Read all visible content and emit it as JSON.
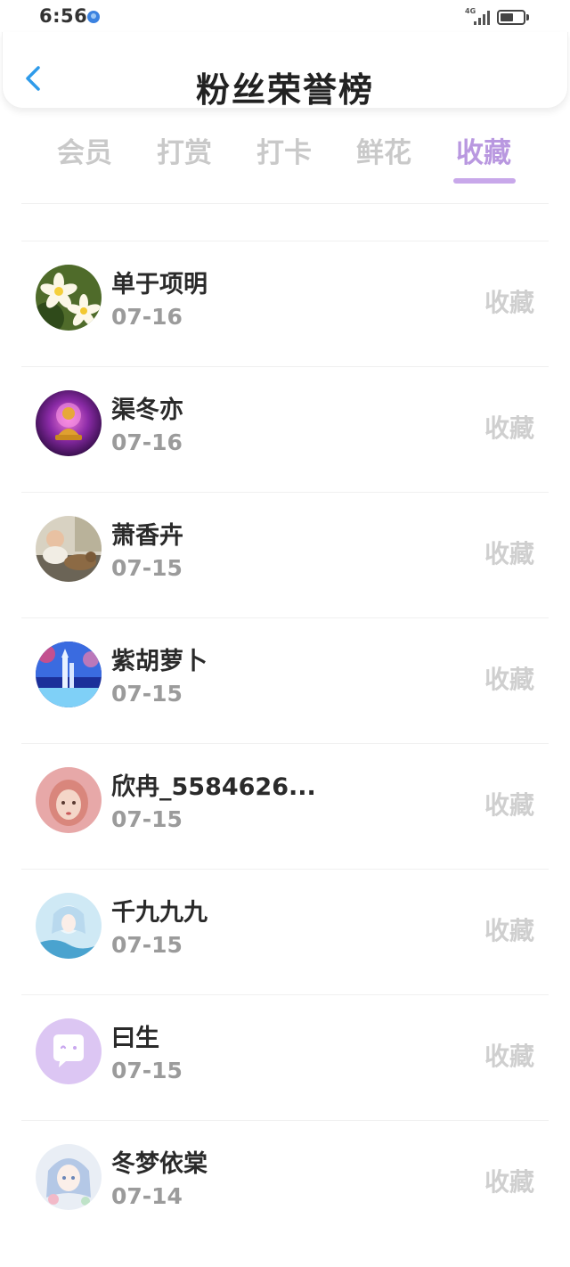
{
  "status_bar": {
    "time": "6:56",
    "network": "4G"
  },
  "header": {
    "title": "粉丝荣誉榜"
  },
  "tabs": [
    {
      "label": "会员",
      "active": false
    },
    {
      "label": "打赏",
      "active": false
    },
    {
      "label": "打卡",
      "active": false
    },
    {
      "label": "鲜花",
      "active": false
    },
    {
      "label": "收藏",
      "active": true
    }
  ],
  "colors": {
    "accent": "#b998e0",
    "underline": "#c8a8ea",
    "back_arrow": "#2f9bea",
    "inactive_tab": "#c9c9c9"
  },
  "fans": [
    {
      "name": "单于项明",
      "date": "07-16",
      "action": "收藏",
      "avatar": "frangipani-flower-avatar"
    },
    {
      "name": "渠冬亦",
      "date": "07-16",
      "action": "收藏",
      "avatar": "golden-buddha-avatar"
    },
    {
      "name": "萧香卉",
      "date": "07-15",
      "action": "收藏",
      "avatar": "baby-and-cat-avatar"
    },
    {
      "name": "紫胡萝卜",
      "date": "07-15",
      "action": "收藏",
      "avatar": "fantasy-castle-avatar"
    },
    {
      "name": "欣冉_5584626...",
      "date": "07-15",
      "action": "收藏",
      "avatar": "painted-girl-avatar"
    },
    {
      "name": "千九九九",
      "date": "07-15",
      "action": "收藏",
      "avatar": "anime-mermaid-avatar"
    },
    {
      "name": "曰生",
      "date": "07-15",
      "action": "收藏",
      "avatar": "chat-bubble-default-avatar"
    },
    {
      "name": "冬梦依棠",
      "date": "07-14",
      "action": "收藏",
      "avatar": "anime-girl-avatar"
    }
  ]
}
